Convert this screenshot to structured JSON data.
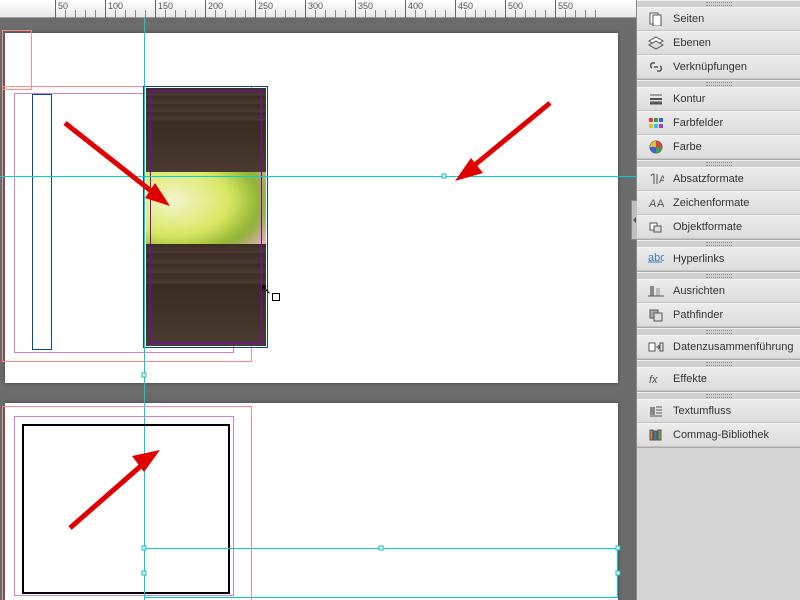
{
  "ruler": {
    "ticks": [
      50,
      100,
      150,
      200,
      250,
      300,
      350,
      400,
      450,
      500,
      550
    ]
  },
  "panels": {
    "group1": [
      {
        "icon": "pages",
        "label": "Seiten"
      },
      {
        "icon": "layers",
        "label": "Ebenen"
      },
      {
        "icon": "links",
        "label": "Verknüpfungen"
      }
    ],
    "group2": [
      {
        "icon": "stroke",
        "label": "Kontur"
      },
      {
        "icon": "swatches",
        "label": "Farbfelder"
      },
      {
        "icon": "color",
        "label": "Farbe"
      }
    ],
    "group3": [
      {
        "icon": "para-styles",
        "label": "Absatzformate"
      },
      {
        "icon": "char-styles",
        "label": "Zeichenformate"
      },
      {
        "icon": "obj-styles",
        "label": "Objektformate"
      }
    ],
    "group4": [
      {
        "icon": "hyperlinks",
        "label": "Hyperlinks"
      }
    ],
    "group5": [
      {
        "icon": "align",
        "label": "Ausrichten"
      },
      {
        "icon": "pathfinder",
        "label": "Pathfinder"
      }
    ],
    "group6": [
      {
        "icon": "data-merge",
        "label": "Datenzusammenführung"
      }
    ],
    "group7": [
      {
        "icon": "effects",
        "label": "Effekte"
      }
    ],
    "group8": [
      {
        "icon": "text-wrap",
        "label": "Textumfluss"
      },
      {
        "icon": "library",
        "label": "Commag-Bibliothek"
      }
    ]
  }
}
